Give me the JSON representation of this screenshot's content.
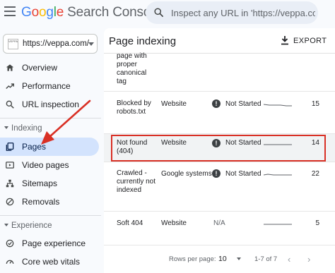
{
  "header": {
    "logo_letters": [
      "G",
      "o",
      "o",
      "g",
      "l",
      "e"
    ],
    "product": "Search Console",
    "search_placeholder": "Inspect any URL in 'https://veppa.com'"
  },
  "sidebar": {
    "property": "https://veppa.com/",
    "favicon_text": "VEPPA",
    "items_top": [
      {
        "label": "Overview",
        "icon": "home-icon"
      },
      {
        "label": "Performance",
        "icon": "trending-up-icon"
      },
      {
        "label": "URL inspection",
        "icon": "search-icon"
      }
    ],
    "section_indexing": "Indexing",
    "items_indexing": [
      {
        "label": "Pages",
        "icon": "pages-icon",
        "active": true
      },
      {
        "label": "Video pages",
        "icon": "video-icon"
      },
      {
        "label": "Sitemaps",
        "icon": "sitemap-icon"
      },
      {
        "label": "Removals",
        "icon": "removals-icon"
      }
    ],
    "section_experience": "Experience",
    "items_experience": [
      {
        "label": "Page experience",
        "icon": "page-experience-icon"
      },
      {
        "label": "Core web vitals",
        "icon": "speed-icon"
      }
    ]
  },
  "main": {
    "title": "Page indexing",
    "export_label": "EXPORT",
    "rows": [
      {
        "reason": "page with proper canonical tag",
        "source": "",
        "validation": "",
        "pages": ""
      },
      {
        "reason": "Blocked by robots.txt",
        "source": "Website",
        "validation": "Not Started",
        "pages": "15"
      },
      {
        "reason": "Not found (404)",
        "source": "Website",
        "validation": "Not Started",
        "pages": "14"
      },
      {
        "reason": "Crawled - currently not indexed",
        "source": "Google systems",
        "validation": "Not Started",
        "pages": "22"
      },
      {
        "reason": "Soft 404",
        "source": "Website",
        "validation": "N/A",
        "pages": "5"
      }
    ],
    "footer": {
      "rows_per_page_label": "Rows per page:",
      "rows_per_page_value": "10",
      "range": "1-7 of 7",
      "prev": "‹",
      "next": "›"
    }
  },
  "colors": {
    "active_nav_bg": "#d3e3fd",
    "highlight_border": "#d93025",
    "annotation_arrow": "#d93025"
  }
}
